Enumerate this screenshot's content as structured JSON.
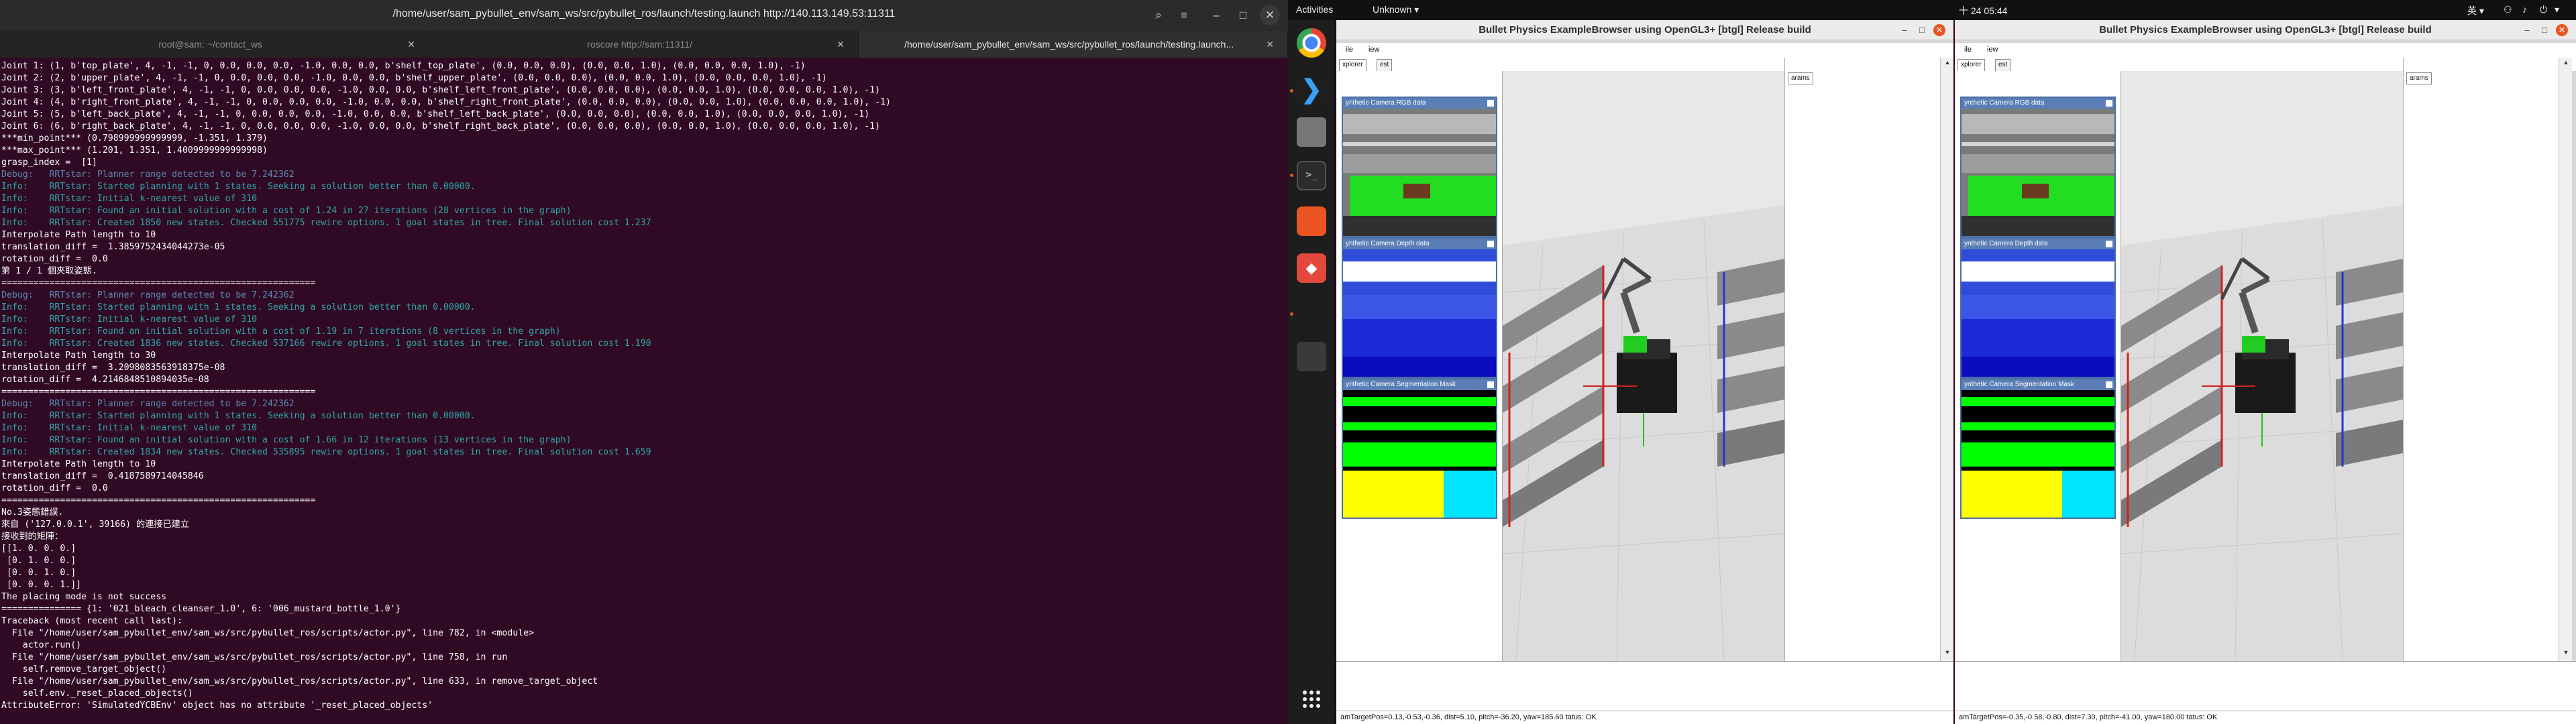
{
  "terminal": {
    "title": "/home/user/sam_pybullet_env/sam_ws/src/pybullet_ros/launch/testing.launch http://140.113.149.53:11311",
    "tabs": [
      {
        "label": "root@sam: ~/contact_ws",
        "active": false
      },
      {
        "label": "roscore http://sam:11311/",
        "active": false
      },
      {
        "label": "/home/user/sam_pybullet_env/sam_ws/src/pybullet_ros/launch/testing.launch...",
        "active": true
      }
    ],
    "lines": [
      {
        "t": "Joint 1: (1, b'top_plate', 4, -1, -1, 0, 0.0, 0.0, 0.0, -1.0, 0.0, 0.0, b'shelf_top_plate', (0.0, 0.0, 0.0), (0.0, 0.0, 1.0), (0.0, 0.0, 0.0, 1.0), -1)",
        "c": "w"
      },
      {
        "t": "Joint 2: (2, b'upper_plate', 4, -1, -1, 0, 0.0, 0.0, 0.0, -1.0, 0.0, 0.0, b'shelf_upper_plate', (0.0, 0.0, 0.0), (0.0, 0.0, 1.0), (0.0, 0.0, 0.0, 1.0), -1)",
        "c": "w"
      },
      {
        "t": "Joint 3: (3, b'left_front_plate', 4, -1, -1, 0, 0.0, 0.0, 0.0, -1.0, 0.0, 0.0, b'shelf_left_front_plate', (0.0, 0.0, 0.0), (0.0, 0.0, 1.0), (0.0, 0.0, 0.0, 1.0), -1)",
        "c": "w"
      },
      {
        "t": "Joint 4: (4, b'right_front_plate', 4, -1, -1, 0, 0.0, 0.0, 0.0, -1.0, 0.0, 0.0, b'shelf_right_front_plate', (0.0, 0.0, 0.0), (0.0, 0.0, 1.0), (0.0, 0.0, 0.0, 1.0), -1)",
        "c": "w"
      },
      {
        "t": "Joint 5: (5, b'left_back_plate', 4, -1, -1, 0, 0.0, 0.0, 0.0, -1.0, 0.0, 0.0, b'shelf_left_back_plate', (0.0, 0.0, 0.0), (0.0, 0.0, 1.0), (0.0, 0.0, 0.0, 1.0), -1)",
        "c": "w"
      },
      {
        "t": "Joint 6: (6, b'right_back_plate', 4, -1, -1, 0, 0.0, 0.0, 0.0, -1.0, 0.0, 0.0, b'shelf_right_back_plate', (0.0, 0.0, 0.0), (0.0, 0.0, 1.0), (0.0, 0.0, 0.0, 1.0), -1)",
        "c": "w"
      },
      {
        "t": "***min_point*** (0.798999999999999, -1.351, 1.379)",
        "c": "w"
      },
      {
        "t": "***max_point*** (1.201, 1.351, 1.4009999999999998)",
        "c": "w"
      },
      {
        "t": "grasp_index =  [1]",
        "c": "w"
      },
      {
        "t": "Debug:   RRTstar: Planner range detected to be 7.242362",
        "c": "d"
      },
      {
        "t": "Info:    RRTstar: Started planning with 1 states. Seeking a solution better than 0.00000.",
        "c": "i"
      },
      {
        "t": "Info:    RRTstar: Initial k-nearest value of 310",
        "c": "i"
      },
      {
        "t": "Info:    RRTstar: Found an initial solution with a cost of 1.24 in 27 iterations (28 vertices in the graph)",
        "c": "i"
      },
      {
        "t": "Info:    RRTstar: Created 1850 new states. Checked 551775 rewire options. 1 goal states in tree. Final solution cost 1.237",
        "c": "i"
      },
      {
        "t": "Interpolate Path length to 10",
        "c": "w"
      },
      {
        "t": "translation_diff =  1.3859752434044273e-05",
        "c": "w"
      },
      {
        "t": "rotation_diff =  0.0",
        "c": "w"
      },
      {
        "t": "第 1 / 1 個夾取姿態.",
        "c": "w"
      },
      {
        "t": "===========================================================",
        "c": "w"
      },
      {
        "t": "Debug:   RRTstar: Planner range detected to be 7.242362",
        "c": "d"
      },
      {
        "t": "Info:    RRTstar: Started planning with 1 states. Seeking a solution better than 0.00000.",
        "c": "i"
      },
      {
        "t": "Info:    RRTstar: Initial k-nearest value of 310",
        "c": "i"
      },
      {
        "t": "Info:    RRTstar: Found an initial solution with a cost of 1.19 in 7 iterations (8 vertices in the graph)",
        "c": "i"
      },
      {
        "t": "Info:    RRTstar: Created 1836 new states. Checked 537166 rewire options. 1 goal states in tree. Final solution cost 1.190",
        "c": "i"
      },
      {
        "t": "Interpolate Path length to 30",
        "c": "w"
      },
      {
        "t": "translation_diff =  3.2098083563918375e-08",
        "c": "w"
      },
      {
        "t": "rotation_diff =  4.2146848510894035e-08",
        "c": "w"
      },
      {
        "t": "===========================================================",
        "c": "w"
      },
      {
        "t": "Debug:   RRTstar: Planner range detected to be 7.242362",
        "c": "d"
      },
      {
        "t": "Info:    RRTstar: Started planning with 1 states. Seeking a solution better than 0.00000.",
        "c": "i"
      },
      {
        "t": "Info:    RRTstar: Initial k-nearest value of 310",
        "c": "i"
      },
      {
        "t": "Info:    RRTstar: Found an initial solution with a cost of 1.66 in 12 iterations (13 vertices in the graph)",
        "c": "i"
      },
      {
        "t": "Info:    RRTstar: Created 1834 new states. Checked 535895 rewire options. 1 goal states in tree. Final solution cost 1.659",
        "c": "i"
      },
      {
        "t": "Interpolate Path length to 10",
        "c": "w"
      },
      {
        "t": "translation_diff =  0.4187589714045846",
        "c": "w"
      },
      {
        "t": "rotation_diff =  0.0",
        "c": "w"
      },
      {
        "t": "===========================================================",
        "c": "w"
      },
      {
        "t": "No.3姿態錯誤.",
        "c": "w"
      },
      {
        "t": "來自 ('127.0.0.1', 39166) 的連接已建立",
        "c": "w"
      },
      {
        "t": "接收到的矩陣：",
        "c": "w"
      },
      {
        "t": "[[1. 0. 0. 0.]",
        "c": "w"
      },
      {
        "t": " [0. 1. 0. 0.]",
        "c": "w"
      },
      {
        "t": " [0. 0. 1. 0.]",
        "c": "w"
      },
      {
        "t": " [0. 0. 0. 1.]]",
        "c": "w"
      },
      {
        "t": "The placing mode is not success",
        "c": "w"
      },
      {
        "t": "=============== {1: '021_bleach_cleanser_1.0', 6: '006_mustard_bottle_1.0'}",
        "c": "w"
      },
      {
        "t": "Traceback (most recent call last):",
        "c": "w"
      },
      {
        "t": "  File \"/home/user/sam_pybullet_env/sam_ws/src/pybullet_ros/scripts/actor.py\", line 782, in <module>",
        "c": "w"
      },
      {
        "t": "    actor.run()",
        "c": "w"
      },
      {
        "t": "  File \"/home/user/sam_pybullet_env/sam_ws/src/pybullet_ros/scripts/actor.py\", line 758, in run",
        "c": "w"
      },
      {
        "t": "    self.remove_target_object()",
        "c": "w"
      },
      {
        "t": "  File \"/home/user/sam_pybullet_env/sam_ws/src/pybullet_ros/scripts/actor.py\", line 633, in remove_target_object",
        "c": "w"
      },
      {
        "t": "    self.env._reset_placed_objects()",
        "c": "w"
      },
      {
        "t": "AttributeError: 'SimulatedYCBEnv' object has no attribute '_reset_placed_objects'",
        "c": "w"
      }
    ]
  },
  "topbar": {
    "activities": "Activities",
    "unknown": "Unknown ▾",
    "clock": "十 24 05:44",
    "lang": "英 ▾"
  },
  "bullet_windows": [
    {
      "title": "Bullet Physics ExampleBrowser using OpenGL3+ [btgl] Release build",
      "menu_file": "ile",
      "menu_view": "iew",
      "tab_explorer": "xplorer",
      "tab_test": "est",
      "params_tab": "arams",
      "rgb_title": "ynthetic Camera RGB data",
      "depth_title": "ynthetic Camera Depth data",
      "seg_title": "ynthetic Camera Segmentation Mask",
      "status": "amTargetPos=0.13,-0.53,-0.36, dist=5.10, pitch=-36.20, yaw=185.60   tatus: OK"
    },
    {
      "title": "Bullet Physics ExampleBrowser using OpenGL3+ [btgl] Release build",
      "menu_file": "ile",
      "menu_view": "iew",
      "tab_explorer": "xplorer",
      "tab_test": "est",
      "params_tab": "arams",
      "rgb_title": "ynthetic Camera RGB data",
      "depth_title": "ynthetic Camera Depth data",
      "seg_title": "ynthetic Camera Segmentation Mask",
      "status": "amTargetPos=-0.35,-0.58,-0.80, dist=7.30, pitch=-41.00, yaw=180.00   tatus: OK"
    }
  ]
}
